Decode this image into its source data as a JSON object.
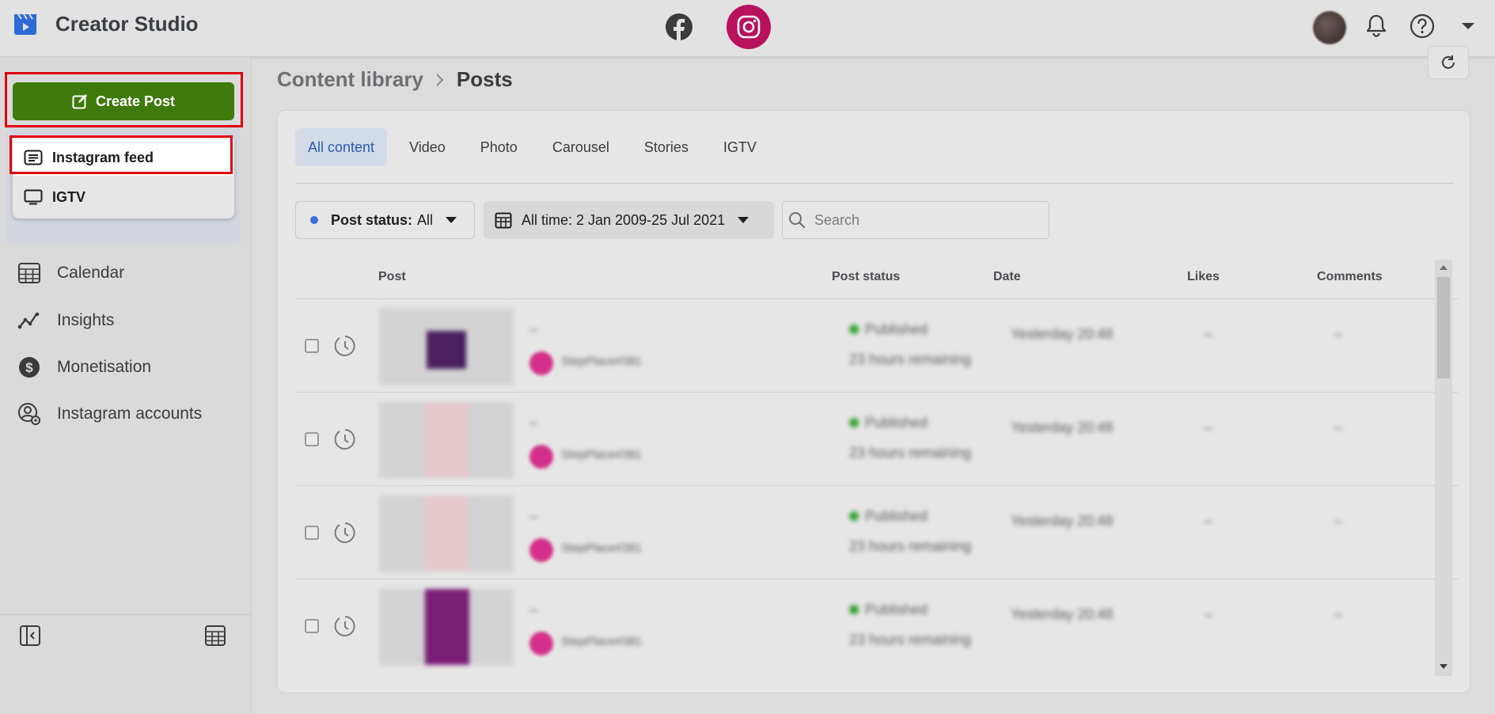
{
  "app": {
    "title": "Creator Studio"
  },
  "sidebar": {
    "create_post_label": "Create Post",
    "create_menu": [
      {
        "label": "Instagram feed",
        "icon": "feed-icon",
        "highlighted": true
      },
      {
        "label": "IGTV",
        "icon": "tv-icon",
        "highlighted": false
      }
    ],
    "nav": [
      {
        "label": "Calendar",
        "icon": "calendar-icon"
      },
      {
        "label": "Insights",
        "icon": "insights-icon"
      },
      {
        "label": "Monetisation",
        "icon": "dollar-icon"
      },
      {
        "label": "Instagram accounts",
        "icon": "account-settings-icon"
      }
    ]
  },
  "breadcrumb": {
    "parent": "Content library",
    "current": "Posts"
  },
  "tabs": [
    {
      "label": "All content",
      "active": true
    },
    {
      "label": "Video",
      "active": false
    },
    {
      "label": "Photo",
      "active": false
    },
    {
      "label": "Carousel",
      "active": false
    },
    {
      "label": "Stories",
      "active": false
    },
    {
      "label": "IGTV",
      "active": false
    }
  ],
  "filters": {
    "status_label": "Post status:",
    "status_value": "All",
    "date_label": "All time: 2 Jan 2009-25 Jul 2021",
    "search_placeholder": "Search"
  },
  "table": {
    "columns": [
      "Post",
      "Post status",
      "Date",
      "Likes",
      "Comments"
    ],
    "rows": [
      {
        "title": "–",
        "account": "StepPlace#381",
        "status": "Published",
        "remaining": "23 hours remaining",
        "date": "Yesterday 20:48",
        "likes": "–",
        "comments": "–"
      },
      {
        "title": "–",
        "account": "StepPlace#381",
        "status": "Published",
        "remaining": "23 hours remaining",
        "date": "Yesterday 20:48",
        "likes": "–",
        "comments": "–"
      },
      {
        "title": "–",
        "account": "StepPlace#381",
        "status": "Published",
        "remaining": "23 hours remaining",
        "date": "Yesterday 20:48",
        "likes": "–",
        "comments": "–"
      },
      {
        "title": "–",
        "account": "StepPlace#381",
        "status": "Published",
        "remaining": "23 hours remaining",
        "date": "Yesterday 20:48",
        "likes": "–",
        "comments": "–"
      }
    ]
  },
  "colors": {
    "create_button": "#3f7a0c",
    "highlight_border": "#e00010",
    "instagram_circle": "#b8115d",
    "active_tab_text": "#2a5ab3",
    "status_dot": "#30a030"
  }
}
